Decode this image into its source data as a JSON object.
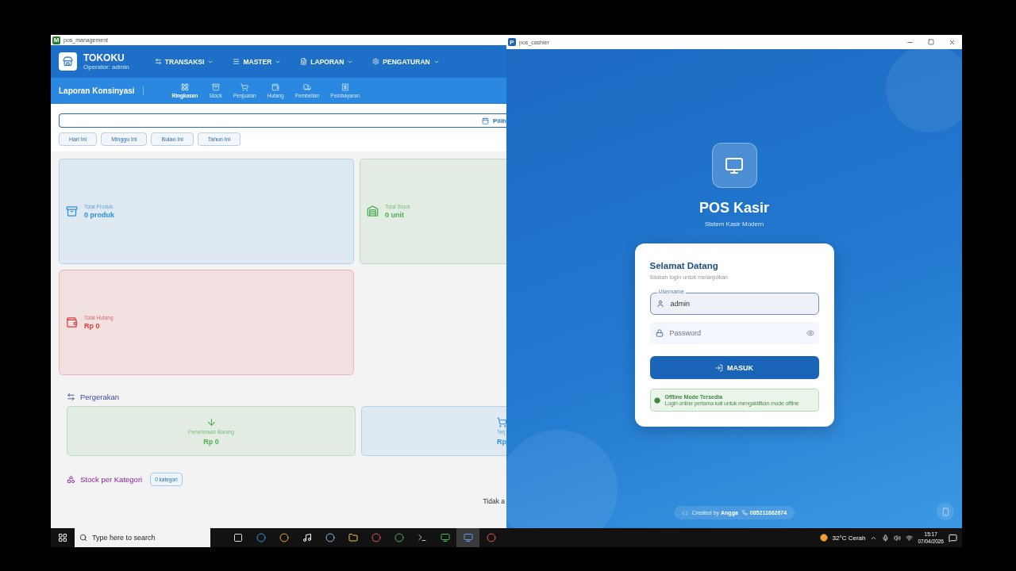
{
  "left_window": {
    "title": "pos_management",
    "app_badge": "M",
    "brand": {
      "name": "TOKOKU",
      "operator": "Operator: admin"
    },
    "menu": [
      {
        "label": "TRANSAKSI"
      },
      {
        "label": "MASTER"
      },
      {
        "label": "LAPORAN"
      },
      {
        "label": "PENGATURAN"
      }
    ],
    "page_title": "Laporan Konsinyasi",
    "tabs": [
      {
        "label": "Ringkasan",
        "selected": true
      },
      {
        "label": "Stock",
        "selected": false
      },
      {
        "label": "Penjualan",
        "selected": false
      },
      {
        "label": "Hutang",
        "selected": false
      },
      {
        "label": "Pembelian",
        "selected": false
      },
      {
        "label": "Pembayaran",
        "selected": false
      }
    ],
    "date_button": "Pilih",
    "quick_ranges": [
      "Hari Ini",
      "Minggu Ini",
      "Bulan Ini",
      "Tahun Ini"
    ],
    "stats": [
      {
        "label": "Total Produk",
        "value": "0 produk",
        "color": "#2d8fe0"
      },
      {
        "label": "Total Stock",
        "value": "0 unit",
        "color": "#4caf50"
      },
      {
        "label": "Total Hutang",
        "value": "Rp 0",
        "color": "#e03a3a"
      }
    ],
    "movement": {
      "title": "Pergerakan",
      "cards": [
        {
          "label": "Penerimaan Barang",
          "value": "Rp 0",
          "color": "#4caf50"
        },
        {
          "label": "Terj",
          "value": "Rp",
          "color": "#2d8fe0"
        }
      ]
    },
    "category": {
      "title": "Stock per Kategori",
      "badge": "0 kategori"
    },
    "empty_text": "Tidak a"
  },
  "right_window": {
    "title": "pos_cashier",
    "app_badge": "P",
    "app_name": "POS Kasir",
    "tagline": "Sistem Kasir Modern",
    "login": {
      "heading": "Selamat Datang",
      "subheading": "Silakan login untuk melanjutkan",
      "username": {
        "label": "Username",
        "value": "admin"
      },
      "password": {
        "placeholder": "Password"
      },
      "submit": "MASUK",
      "notice": {
        "title": "Offline Mode Tersedia",
        "text": "Login online pertama kali untuk mengaktifkan mode offline"
      }
    },
    "footer": {
      "credit": "Created by **Angga**",
      "phone": "085211662674"
    }
  },
  "taskbar": {
    "search_placeholder": "Type here to search",
    "weather": "32°C Cerah",
    "time": "15:17",
    "date": "07/04/2026"
  }
}
